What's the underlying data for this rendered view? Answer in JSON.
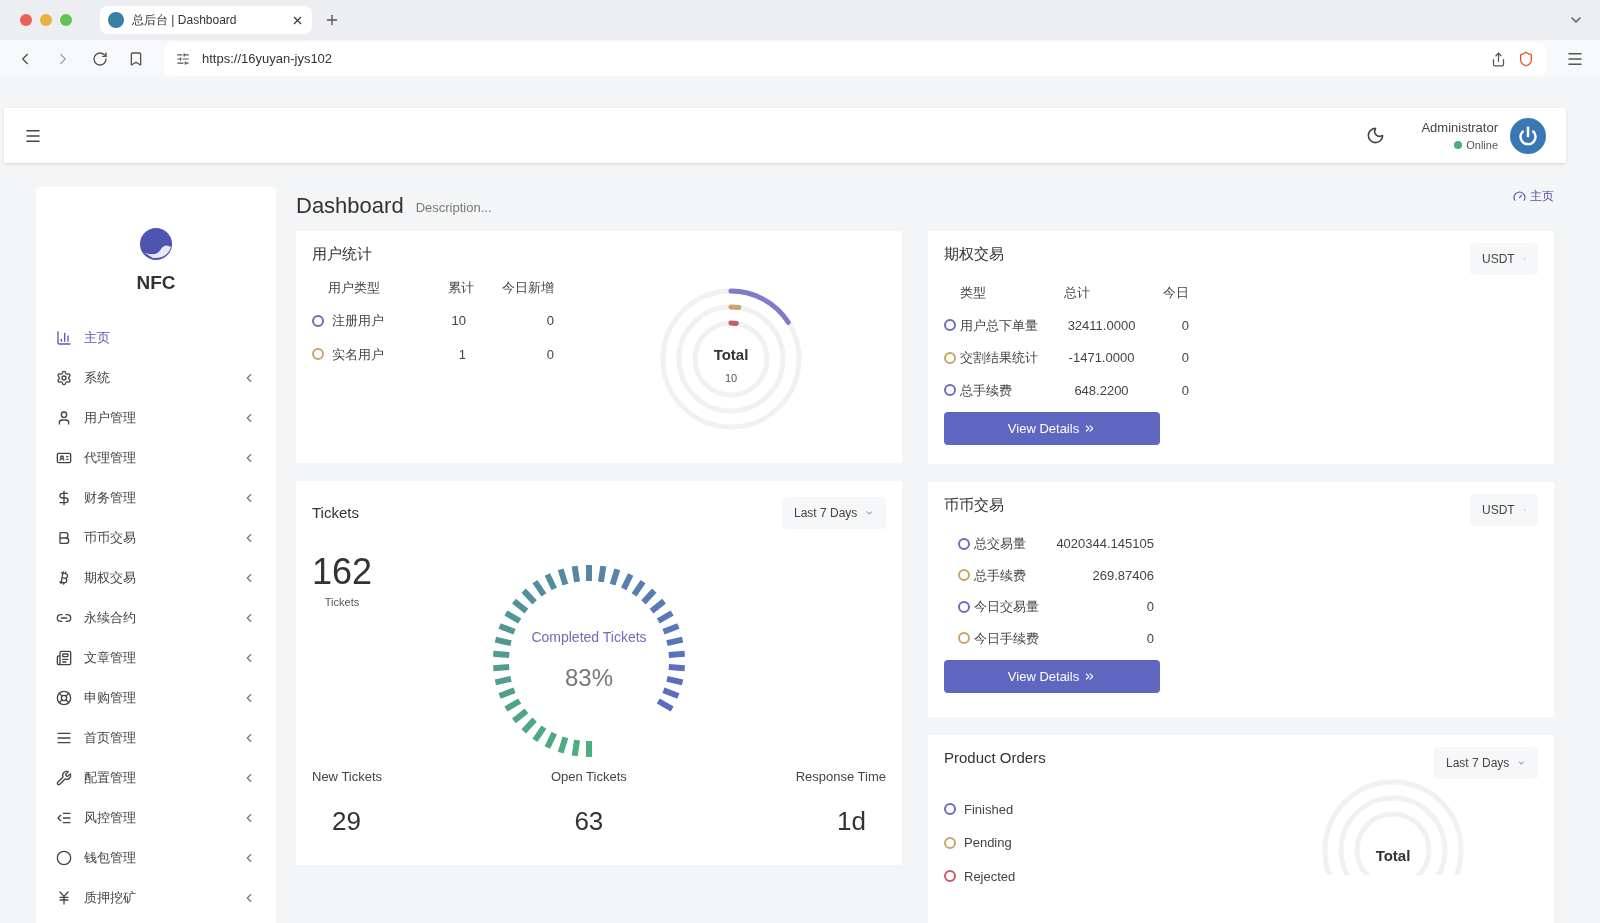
{
  "browser": {
    "tab_title": "总后台 | Dashboard",
    "url": "https://16yuyan-jys102"
  },
  "header": {
    "user_name": "Administrator",
    "status": "Online"
  },
  "sidebar": {
    "brand": "NFC",
    "items": [
      {
        "label": "主页",
        "selected": true
      },
      {
        "label": "系统",
        "selected": false
      },
      {
        "label": "用户管理",
        "selected": false
      },
      {
        "label": "代理管理",
        "selected": false
      },
      {
        "label": "财务管理",
        "selected": false
      },
      {
        "label": "币币交易",
        "selected": false
      },
      {
        "label": "期权交易",
        "selected": false
      },
      {
        "label": "永续合约",
        "selected": false
      },
      {
        "label": "文章管理",
        "selected": false
      },
      {
        "label": "申购管理",
        "selected": false
      },
      {
        "label": "首页管理",
        "selected": false
      },
      {
        "label": "配置管理",
        "selected": false
      },
      {
        "label": "风控管理",
        "selected": false
      },
      {
        "label": "钱包管理",
        "selected": false
      },
      {
        "label": "质押挖矿",
        "selected": false
      }
    ]
  },
  "page": {
    "title": "Dashboard",
    "description": "Description...",
    "breadcrumb": "主页"
  },
  "user_stats": {
    "title": "用户统计",
    "columns": [
      "用户类型",
      "累计",
      "今日新增"
    ],
    "rows": [
      {
        "label": "注册用户",
        "total": "10",
        "today": "0",
        "color": "#6f6bbd"
      },
      {
        "label": "实名用户",
        "total": "1",
        "today": "0",
        "color": "#c9a46a"
      }
    ],
    "ring_label": "Total",
    "ring_value": "10"
  },
  "tickets": {
    "title": "Tickets",
    "range": "Last 7 Days",
    "count": "162",
    "count_label": "Tickets",
    "gauge_label": "Completed Tickets",
    "gauge_value": "83%",
    "stats": [
      {
        "label": "New Tickets",
        "value": "29"
      },
      {
        "label": "Open Tickets",
        "value": "63"
      },
      {
        "label": "Response Time",
        "value": "1d"
      }
    ]
  },
  "options": {
    "title": "期权交易",
    "currency": "USDT",
    "columns": [
      "类型",
      "总计",
      "今日"
    ],
    "rows": [
      {
        "label": "用户总下单量",
        "total": "32411.0000",
        "today": "0",
        "color": "#6f6bbd"
      },
      {
        "label": "交割结果统计",
        "total": "-1471.0000",
        "today": "0",
        "color": "#c9a46a"
      },
      {
        "label": "总手续费",
        "total": "648.2200",
        "today": "0",
        "color": "#6f6bbd"
      }
    ],
    "button": "View Details"
  },
  "coin": {
    "title": "币币交易",
    "currency": "USDT",
    "rows": [
      {
        "label": "总交易量",
        "value": "4020344.145105",
        "color": "#6f6bbd"
      },
      {
        "label": "总手续费",
        "value": "269.87406",
        "color": "#c9a46a"
      },
      {
        "label": "今日交易量",
        "value": "0",
        "color": "#6f6bbd"
      },
      {
        "label": "今日手续费",
        "value": "0",
        "color": "#c9a46a"
      }
    ],
    "button": "View Details"
  },
  "orders": {
    "title": "Product Orders",
    "range": "Last 7 Days",
    "rows": [
      {
        "label": "Finished",
        "color": "#6f6bbd"
      },
      {
        "label": "Pending",
        "color": "#c9a46a"
      },
      {
        "label": "Rejected",
        "color": "#c45c6a"
      }
    ],
    "ring_label": "Total"
  }
}
